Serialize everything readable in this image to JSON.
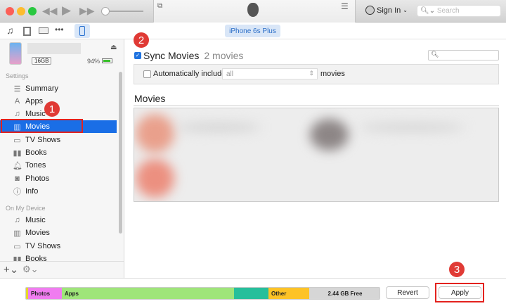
{
  "titlebar": {
    "sign_in": "Sign In",
    "search_placeholder": "Search"
  },
  "toolbar": {
    "device_tab": "iPhone 6s Plus"
  },
  "device": {
    "capacity": "16GB",
    "battery": "94%"
  },
  "sidebar": {
    "settings_label": "Settings",
    "settings_items": [
      {
        "label": "Summary",
        "icon": "summary-icon"
      },
      {
        "label": "Apps",
        "icon": "apps-icon"
      },
      {
        "label": "Music",
        "icon": "music-icon"
      },
      {
        "label": "Movies",
        "icon": "movies-icon",
        "selected": true
      },
      {
        "label": "TV Shows",
        "icon": "tv-icon"
      },
      {
        "label": "Books",
        "icon": "books-icon"
      },
      {
        "label": "Tones",
        "icon": "bell-icon"
      },
      {
        "label": "Photos",
        "icon": "camera-icon"
      },
      {
        "label": "Info",
        "icon": "info-icon"
      }
    ],
    "device_label": "On My Device",
    "device_items": [
      {
        "label": "Music"
      },
      {
        "label": "Movies"
      },
      {
        "label": "TV Shows"
      },
      {
        "label": "Books"
      }
    ]
  },
  "main": {
    "sync_label": "Sync Movies",
    "sync_count": "2 movies",
    "sync_checked": true,
    "auto_include_label": "Automatically include",
    "auto_include_value": "all",
    "auto_include_suffix": "movies",
    "movies_heading": "Movies"
  },
  "storage": {
    "segments": [
      {
        "label": "Photos",
        "color": "#f07cf0"
      },
      {
        "label": "Apps",
        "color": "#9fe57a"
      },
      {
        "label": "",
        "color": "#26bf9b"
      },
      {
        "label": "Other",
        "color": "#fdc326"
      },
      {
        "label": "2.44 GB Free",
        "color": "#d6d6d6"
      }
    ]
  },
  "buttons": {
    "revert": "Revert",
    "apply": "Apply"
  },
  "badges": [
    "1",
    "2",
    "3"
  ]
}
